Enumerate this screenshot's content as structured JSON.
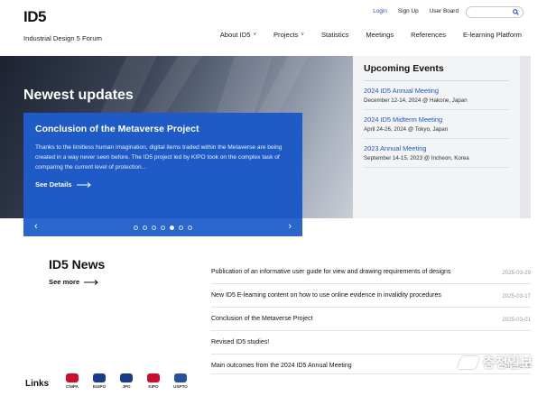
{
  "header": {
    "logo_text": "ID5",
    "tagline": "Industrial Design 5 Forum",
    "util": {
      "login": "Login",
      "signup": "Sign Up",
      "board": "User Board"
    },
    "search_placeholder": ""
  },
  "nav": {
    "items": [
      {
        "label": "About ID5",
        "has_menu": true
      },
      {
        "label": "Projects",
        "has_menu": true
      },
      {
        "label": "Statistics",
        "has_menu": false
      },
      {
        "label": "Meetings",
        "has_menu": false
      },
      {
        "label": "References",
        "has_menu": false
      },
      {
        "label": "E-learning Platform",
        "has_menu": false
      }
    ]
  },
  "hero": {
    "section_title": "Newest updates",
    "card_title": "Conclusion of the Metaverse Project",
    "card_text": "Thanks to the limitless human imagination, digital items traded within the Metaverse are being created in a way never seen before. The ID5 project led by KIPO took on the complex task of comparing the current level of protection...",
    "see_details": "See Details",
    "slide_count": 7,
    "active_slide": 5
  },
  "events": {
    "title": "Upcoming Events",
    "items": [
      {
        "name": "2024 ID5 Annual Meeting",
        "detail": "December 12-14, 2024 @ Hakone, Japan"
      },
      {
        "name": "2024 ID5 Midterm Meeting",
        "detail": "April 24-26, 2024 @ Tokyo, Japan"
      },
      {
        "name": "2023 Annual Meeting",
        "detail": "September 14-15, 2023 @ Incheon, Korea"
      }
    ]
  },
  "news": {
    "title": "ID5 News",
    "see_more": "See more",
    "items": [
      {
        "title": "Publication of an informative user guide for view and drawing requirements of designs",
        "date": "2025-03-29"
      },
      {
        "title": "New ID5 E-learning content on how to use online evidence in invalidity procedures",
        "date": "2025-03-17"
      },
      {
        "title": "Conclusion of the Metaverse Project",
        "date": "2025-03-01"
      },
      {
        "title": "Revised ID5 studies!",
        "date": ""
      },
      {
        "title": "Main outcomes from the 2024 ID5 Annual Meeting",
        "date": "2025-01-08"
      }
    ]
  },
  "links": {
    "label": "Links",
    "orgs": [
      {
        "name": "CNIPA",
        "color": "#c8102e"
      },
      {
        "name": "EUIPO",
        "color": "#1a3a8a"
      },
      {
        "name": "JPO",
        "color": "#1a3a8a"
      },
      {
        "name": "KIPO",
        "color": "#c8102e"
      },
      {
        "name": "USPTO",
        "color": "#2a4f9a"
      }
    ]
  },
  "watermark": {
    "text": "충청일보"
  },
  "colors": {
    "accent": "#1e5bc7",
    "link": "#1f57c3",
    "events_bg": "#f3f4f6"
  }
}
